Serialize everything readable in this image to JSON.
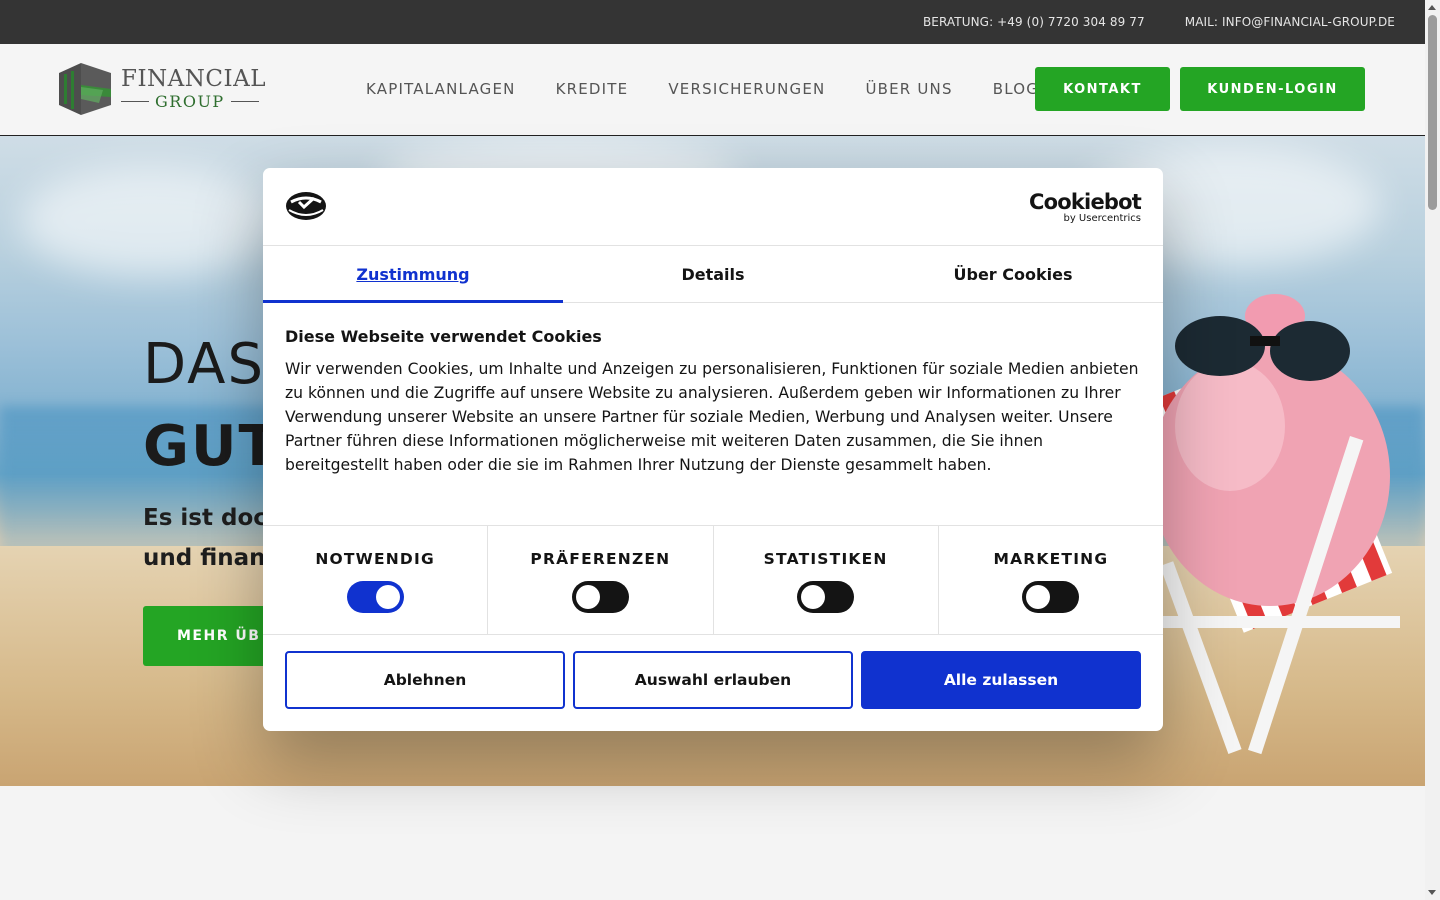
{
  "topbar": {
    "beratung": "BERATUNG: +49 (0) 7720 304 89 77",
    "mail": "MAIL: INFO@FINANCIAL-GROUP.DE"
  },
  "logo": {
    "line1": "FINANCIAL",
    "line2": "GROUP"
  },
  "nav": {
    "items": [
      "KAPITALANLAGEN",
      "KREDITE",
      "VERSICHERUNGEN",
      "ÜBER UNS",
      "BLOG"
    ],
    "kontakt": "KONTAKT",
    "login": "KUNDEN-LOGIN"
  },
  "hero": {
    "title1": "DAS",
    "title2": "GUT",
    "subtitle_line1": "Es ist doch",
    "subtitle_line2": "und finan",
    "button": "MEHR ÜB"
  },
  "cookie": {
    "brand": "Cookiebot",
    "brand_sub": "by Usercentrics",
    "tabs": [
      "Zustimmung",
      "Details",
      "Über Cookies"
    ],
    "heading": "Diese Webseite verwendet Cookies",
    "text": "Wir verwenden Cookies, um Inhalte und Anzeigen zu personalisieren, Funktionen für soziale Medien anbieten zu können und die Zugriffe auf unsere Website zu analysieren. Außerdem geben wir Informationen zu Ihrer Verwendung unserer Website an unsere Partner für soziale Medien, Werbung und Analysen weiter. Unsere Partner führen diese Informationen möglicherweise mit weiteren Daten zusammen, die Sie ihnen bereitgestellt haben oder die sie im Rahmen Ihrer Nutzung der Dienste gesammelt haben.",
    "categories": [
      {
        "label": "NOTWENDIG",
        "enabled": true
      },
      {
        "label": "PRÄFERENZEN",
        "enabled": false
      },
      {
        "label": "STATISTIKEN",
        "enabled": false
      },
      {
        "label": "MARKETING",
        "enabled": false
      }
    ],
    "buttons": {
      "decline": "Ablehnen",
      "allow_selection": "Auswahl erlauben",
      "allow_all": "Alle zulassen"
    },
    "accent_color": "#1032cf"
  },
  "colors": {
    "brand_green": "#24a524",
    "topbar": "#343434"
  }
}
